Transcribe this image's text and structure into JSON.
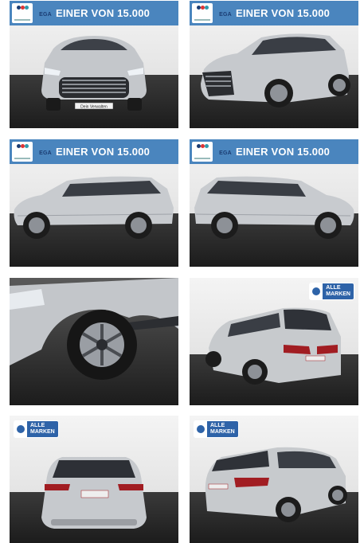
{
  "gallery": {
    "banner_text": "EINER VON 15.000",
    "ega_logo_text": "EGA",
    "alle_line1": "ALLE",
    "alle_line2": "MARKEN",
    "plate_text": "Dein Verwalten",
    "colors": {
      "banner": "#4a85be",
      "car_silver": "#c9ccd0",
      "floor": "#262626"
    },
    "images": [
      {
        "view": "front"
      },
      {
        "view": "front-three-quarter"
      },
      {
        "view": "side-left"
      },
      {
        "view": "side-right"
      },
      {
        "view": "wheel-detail"
      },
      {
        "view": "rear-three-quarter"
      },
      {
        "view": "rear"
      },
      {
        "view": "rear-three-quarter-left"
      }
    ]
  }
}
